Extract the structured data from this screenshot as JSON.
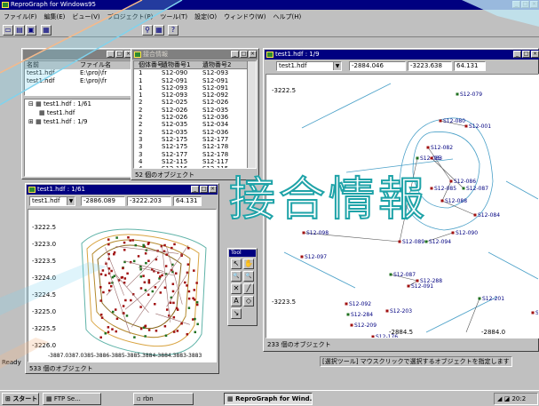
{
  "app": {
    "title": "ReproGraph for Windows95"
  },
  "menu": [
    "ファイル(F)",
    "編集(E)",
    "ビュー(V)",
    "プロジェクト(P)",
    "ツール(T)",
    "設定(O)",
    "ウィンドウ(W)",
    "ヘルプ(H)"
  ],
  "project": {
    "headers": [
      "名前",
      "ファイル名"
    ],
    "rows": [
      {
        "name": "test1.hdf",
        "path": "E:\\proj\\fr"
      },
      {
        "name": "test1.hdf",
        "path": "E:\\proj\\fr"
      }
    ],
    "tree": [
      "test1.hdf : 1/61",
      "test1.hdf",
      "test1.hdf : 1/9"
    ]
  },
  "joint": {
    "title": "接合情報",
    "headers": [
      "個体番号",
      "遺物番号1",
      "遺物番号2"
    ],
    "rows": [
      [
        "1",
        "S12-090",
        "S12-093"
      ],
      [
        "1",
        "S12-091",
        "S12-091"
      ],
      [
        "1",
        "S12-093",
        "S12-091"
      ],
      [
        "1",
        "S12-093",
        "S12-092"
      ],
      [
        "2",
        "S12-025",
        "S12-026"
      ],
      [
        "2",
        "S12-026",
        "S12-035"
      ],
      [
        "2",
        "S12-026",
        "S12-036"
      ],
      [
        "2",
        "S12-035",
        "S12-034"
      ],
      [
        "2",
        "S12-035",
        "S12-036"
      ],
      [
        "3",
        "S12-175",
        "S12-177"
      ],
      [
        "3",
        "S12-175",
        "S12-178"
      ],
      [
        "3",
        "S12-177",
        "S12-178"
      ],
      [
        "4",
        "S12-115",
        "S12-117"
      ],
      [
        "4",
        "S12-116",
        "S12-115"
      ],
      [
        "4",
        "S12-116",
        "S12-117"
      ]
    ],
    "status": "52 個のオブジェクト"
  },
  "map_small": {
    "title": "test1.hdf : 1/61",
    "layer": "test1.hdf",
    "x": "-2886.089",
    "y": "-3222.203",
    "scale": "64.131",
    "y_ticks": [
      "-3222.5",
      "-3223.0",
      "-3223.5",
      "-3224.0",
      "-3224.5",
      "-3225.0",
      "-3225.5",
      "-3226.0"
    ],
    "x_ticks": "-3887.0387.0385-3886-3885-3885.3884-3884.3883-3883",
    "status": "533 個のオブジェクト"
  },
  "map_large": {
    "title": "test1.hdf : 1/9",
    "layer": "test1.hdf",
    "x": "-2884.046",
    "y": "-3223.638",
    "scale": "64.131",
    "y_ticks": [
      "-3222.5",
      "-3223.5"
    ],
    "x_ticks": [
      "-2884.5",
      "-2884.0"
    ],
    "labels": [
      "S12-079",
      "S12-080",
      "S12-001",
      "S12-082",
      "S12-083",
      "15",
      "S12-086",
      "S12-085",
      "S12-087",
      "S12-088",
      "S12-084",
      "S12-089",
      "S12-094",
      "S12-090",
      "S12-098",
      "S12-097",
      "S12-087",
      "S12-288",
      "S12-091",
      "S12-092",
      "S12-284",
      "S12-203",
      "S12-209",
      "S12-202",
      "S12-201",
      "S12-175",
      "S12-176"
    ],
    "status": "233 個のオブジェクト"
  },
  "tools": {
    "title": "Tool",
    "items": [
      "↖",
      "✋",
      "🔍",
      "🔍",
      "✕",
      "╱",
      "A",
      "◇",
      "↘"
    ]
  },
  "overlay_text": "接合情報",
  "statusbar": {
    "ready": "Ready",
    "hint": "[選択ツール] マウスクリックで選択するオブジェクトを指定します"
  },
  "taskbar": {
    "start": "スタート",
    "tasks": [
      "FTP Se...",
      "rbn",
      "ReproGraph for Wind..."
    ],
    "clock": "20:2"
  },
  "colors": {
    "title_active": "#000080",
    "title_inactive": "#808080",
    "overlay": "#1fa3a8",
    "map_bg": "#ffffff",
    "point_red": "#a01010",
    "point_green": "#207020"
  }
}
